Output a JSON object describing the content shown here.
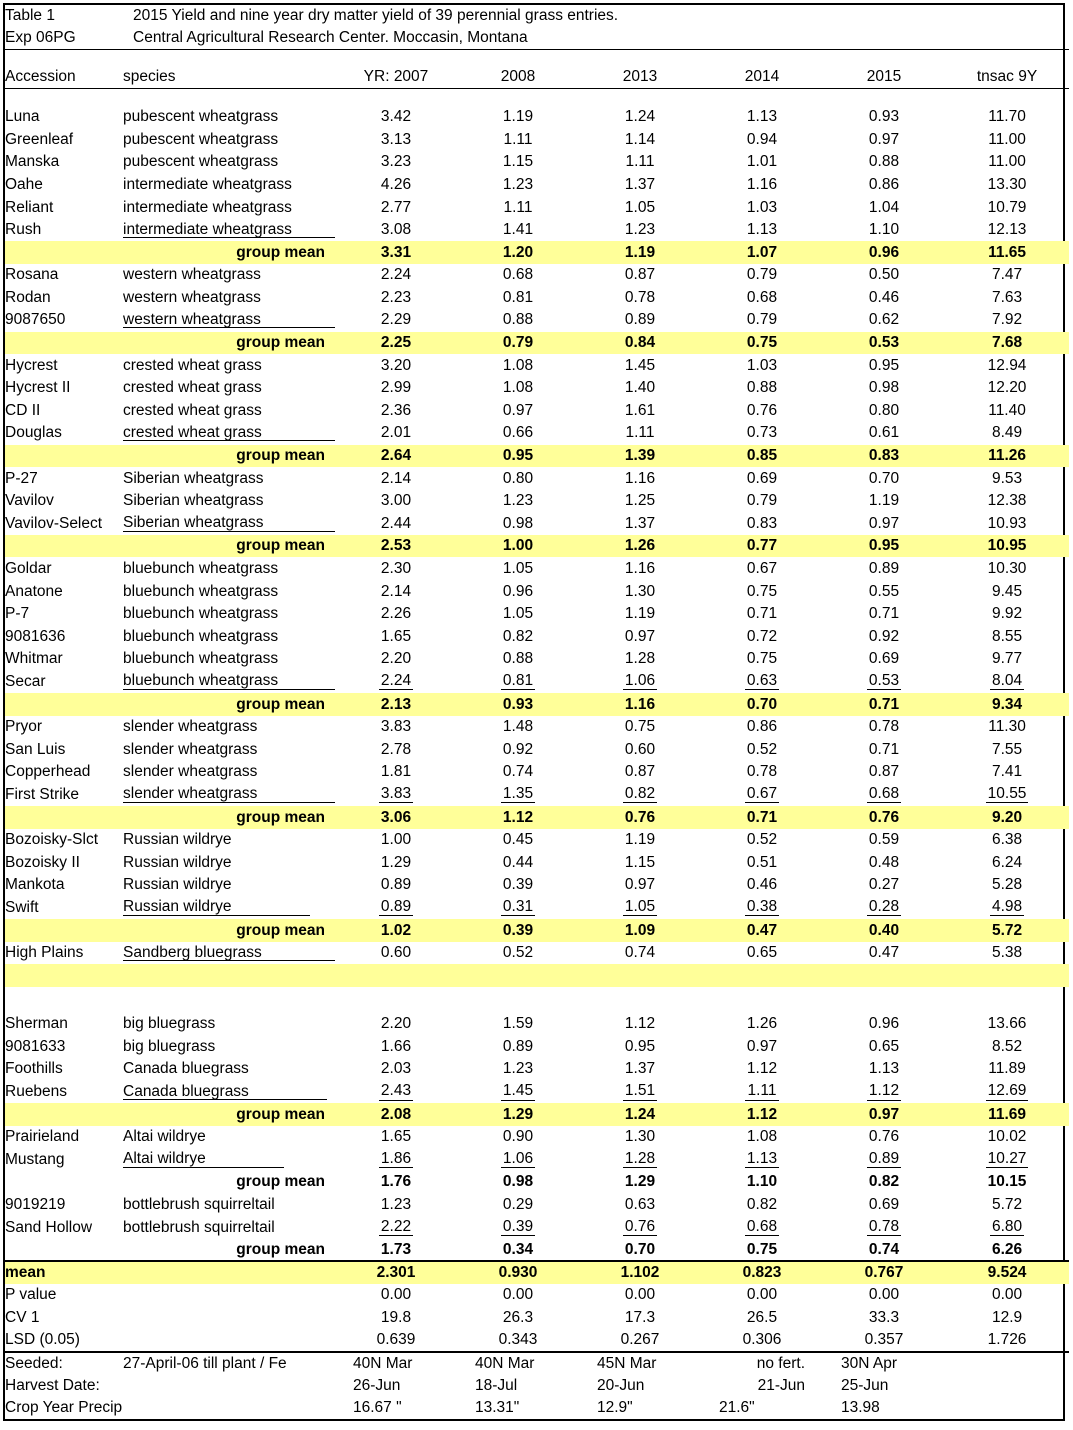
{
  "title": {
    "label": "Table  1",
    "text": "2015 Yield and nine year dry matter yield of 39 perennial grass entries.",
    "exp_label": "Exp 06PG",
    "exp_text": "Central Agricultural Research Center. Moccasin, Montana"
  },
  "colors": {
    "highlight": "#ffff99",
    "border": "#000000",
    "background": "#ffffff"
  },
  "headers": {
    "accession": "Accession",
    "species": "species",
    "year_2007": "YR: 2007",
    "year_2008": "2008",
    "year_2013": "2013",
    "year_2014": "2014",
    "year_2015": "2015",
    "total": "tnsac 9Y"
  },
  "group_mean_label": "group mean",
  "groups": [
    {
      "rows": [
        {
          "accession": "Luna",
          "species": "pubescent wheatgrass",
          "v": [
            "3.42",
            "1.19",
            "1.24",
            "1.13",
            "0.93",
            "11.70"
          ]
        },
        {
          "accession": "Greenleaf",
          "species": "pubescent wheatgrass",
          "v": [
            "3.13",
            "1.11",
            "1.14",
            "0.94",
            "0.97",
            "11.00"
          ]
        },
        {
          "accession": "Manska",
          "species": "pubescent wheatgrass",
          "v": [
            "3.23",
            "1.15",
            "1.11",
            "1.01",
            "0.88",
            "11.00"
          ]
        },
        {
          "accession": "Oahe",
          "species": "intermediate wheatgrass",
          "v": [
            "4.26",
            "1.23",
            "1.37",
            "1.16",
            "0.86",
            "13.30"
          ]
        },
        {
          "accession": "Reliant",
          "species": "intermediate wheatgrass",
          "v": [
            "2.77",
            "1.11",
            "1.05",
            "1.03",
            "1.04",
            "10.79"
          ]
        },
        {
          "accession": "Rush",
          "species": "intermediate wheatgrass",
          "v": [
            "3.08",
            "1.41",
            "1.23",
            "1.13",
            "1.10",
            "12.13"
          ],
          "underline_species": true
        }
      ],
      "mean": {
        "v": [
          "3.31",
          "1.20",
          "1.19",
          "1.07",
          "0.96",
          "11.65"
        ],
        "highlight": true
      }
    },
    {
      "rows": [
        {
          "accession": "Rosana",
          "species": "western wheatgrass",
          "v": [
            "2.24",
            "0.68",
            "0.87",
            "0.79",
            "0.50",
            "7.47"
          ]
        },
        {
          "accession": "Rodan",
          "species": "western wheatgrass",
          "v": [
            "2.23",
            "0.81",
            "0.78",
            "0.68",
            "0.46",
            "7.63"
          ]
        },
        {
          "accession": "9087650",
          "species": "western wheatgrass",
          "v": [
            "2.29",
            "0.88",
            "0.89",
            "0.79",
            "0.62",
            "7.92"
          ],
          "underline_species": true
        }
      ],
      "mean": {
        "v": [
          "2.25",
          "0.79",
          "0.84",
          "0.75",
          "0.53",
          "7.68"
        ],
        "highlight": true
      }
    },
    {
      "rows": [
        {
          "accession": "Hycrest",
          "species": "crested wheat grass",
          "v": [
            "3.20",
            "1.08",
            "1.45",
            "1.03",
            "0.95",
            "12.94"
          ]
        },
        {
          "accession": "Hycrest II",
          "species": "crested wheat grass",
          "v": [
            "2.99",
            "1.08",
            "1.40",
            "0.88",
            "0.98",
            "12.20"
          ]
        },
        {
          "accession": "CD II",
          "species": "crested wheat grass",
          "v": [
            "2.36",
            "0.97",
            "1.61",
            "0.76",
            "0.80",
            "11.40"
          ]
        },
        {
          "accession": "Douglas",
          "species": "crested wheat grass",
          "v": [
            "2.01",
            "0.66",
            "1.11",
            "0.73",
            "0.61",
            "8.49"
          ],
          "underline_species": true
        }
      ],
      "mean": {
        "v": [
          "2.64",
          "0.95",
          "1.39",
          "0.85",
          "0.83",
          "11.26"
        ],
        "highlight": true
      }
    },
    {
      "rows": [
        {
          "accession": "P-27",
          "species": "Siberian wheatgrass",
          "v": [
            "2.14",
            "0.80",
            "1.16",
            "0.69",
            "0.70",
            "9.53"
          ]
        },
        {
          "accession": "Vavilov",
          "species": "Siberian wheatgrass",
          "v": [
            "3.00",
            "1.23",
            "1.25",
            "0.79",
            "1.19",
            "12.38"
          ]
        },
        {
          "accession": "Vavilov-Select",
          "species": "Siberian wheatgrass",
          "v": [
            "2.44",
            "0.98",
            "1.37",
            "0.83",
            "0.97",
            "10.93"
          ],
          "underline_species": true
        }
      ],
      "mean": {
        "v": [
          "2.53",
          "1.00",
          "1.26",
          "0.77",
          "0.95",
          "10.95"
        ],
        "highlight": true
      }
    },
    {
      "rows": [
        {
          "accession": "Goldar",
          "species": "bluebunch wheatgrass",
          "v": [
            "2.30",
            "1.05",
            "1.16",
            "0.67",
            "0.89",
            "10.30"
          ]
        },
        {
          "accession": "Anatone",
          "species": "bluebunch wheatgrass",
          "v": [
            "2.14",
            "0.96",
            "1.30",
            "0.75",
            "0.55",
            "9.45"
          ]
        },
        {
          "accession": "P-7",
          "species": "bluebunch wheatgrass",
          "v": [
            "2.26",
            "1.05",
            "1.19",
            "0.71",
            "0.71",
            "9.92"
          ]
        },
        {
          "accession": "9081636",
          "species": "bluebunch wheatgrass",
          "v": [
            "1.65",
            "0.82",
            "0.97",
            "0.72",
            "0.92",
            "8.55"
          ]
        },
        {
          "accession": "Whitmar",
          "species": "bluebunch wheatgrass",
          "v": [
            "2.20",
            "0.88",
            "1.28",
            "0.75",
            "0.69",
            "9.77"
          ]
        },
        {
          "accession": "Secar",
          "species": "bluebunch wheatgrass",
          "v": [
            "2.24",
            "0.81",
            "1.06",
            "0.63",
            "0.53",
            "8.04"
          ],
          "underline_species": true,
          "underline_values": true
        }
      ],
      "mean": {
        "v": [
          "2.13",
          "0.93",
          "1.16",
          "0.70",
          "0.71",
          "9.34"
        ],
        "highlight": true
      }
    },
    {
      "rows": [
        {
          "accession": "Pryor",
          "species": "slender wheatgrass",
          "v": [
            "3.83",
            "1.48",
            "0.75",
            "0.86",
            "0.78",
            "11.30"
          ]
        },
        {
          "accession": "San Luis",
          "species": "slender wheatgrass",
          "v": [
            "2.78",
            "0.92",
            "0.60",
            "0.52",
            "0.71",
            "7.55"
          ]
        },
        {
          "accession": "Copperhead",
          "species": "slender wheatgrass",
          "v": [
            "1.81",
            "0.74",
            "0.87",
            "0.78",
            "0.87",
            "7.41"
          ]
        },
        {
          "accession": "First Strike",
          "species": "slender wheatgrass",
          "v": [
            "3.83",
            "1.35",
            "0.82",
            "0.67",
            "0.68",
            "10.55"
          ],
          "underline_species": true,
          "underline_values": true
        }
      ],
      "mean": {
        "v": [
          "3.06",
          "1.12",
          "0.76",
          "0.71",
          "0.76",
          "9.20"
        ],
        "highlight": true
      }
    },
    {
      "rows": [
        {
          "accession": "Bozoisky-Slct",
          "species": "Russian wildrye",
          "v": [
            "1.00",
            "0.45",
            "1.19",
            "0.52",
            "0.59",
            "6.38"
          ]
        },
        {
          "accession": "Bozoisky II",
          "species": "Russian wildrye",
          "v": [
            "1.29",
            "0.44",
            "1.15",
            "0.51",
            "0.48",
            "6.24"
          ]
        },
        {
          "accession": "Mankota",
          "species": "Russian wildrye",
          "v": [
            "0.89",
            "0.39",
            "0.97",
            "0.46",
            "0.27",
            "5.28"
          ]
        },
        {
          "accession": "Swift",
          "species": "Russian wildrye",
          "v": [
            "0.89",
            "0.31",
            "1.05",
            "0.38",
            "0.28",
            "4.98"
          ],
          "underline_species": true,
          "underline_values": true
        }
      ],
      "mean": {
        "v": [
          "1.02",
          "0.39",
          "1.09",
          "0.47",
          "0.40",
          "5.72"
        ],
        "highlight": true
      }
    },
    {
      "rows": [
        {
          "accession": "High Plains",
          "species": "Sandberg bluegrass",
          "v": [
            "0.60",
            "0.52",
            "0.74",
            "0.65",
            "0.47",
            "5.38"
          ],
          "underline_species": true
        }
      ],
      "mean": {
        "v": [
          "",
          "",
          "",
          "",
          "",
          ""
        ],
        "highlight": true
      },
      "gap_after": true
    },
    {
      "rows": [
        {
          "accession": "Sherman",
          "species": "big bluegrass",
          "v": [
            "2.20",
            "1.59",
            "1.12",
            "1.26",
            "0.96",
            "13.66"
          ]
        },
        {
          "accession": "9081633",
          "species": "big bluegrass",
          "v": [
            "1.66",
            "0.89",
            "0.95",
            "0.97",
            "0.65",
            "8.52"
          ]
        },
        {
          "accession": "Foothills",
          "species": "Canada bluegrass",
          "v": [
            "2.03",
            "1.23",
            "1.37",
            "1.12",
            "1.13",
            "11.89"
          ]
        },
        {
          "accession": "Ruebens",
          "species": "Canada bluegrass",
          "v": [
            "2.43",
            "1.45",
            "1.51",
            "1.11",
            "1.12",
            "12.69"
          ],
          "underline_species": true,
          "underline_values": true
        }
      ],
      "mean": {
        "v": [
          "2.08",
          "1.29",
          "1.24",
          "1.12",
          "0.97",
          "11.69"
        ],
        "highlight": true
      }
    },
    {
      "rows": [
        {
          "accession": "Prairieland",
          "species": "Altai wildrye",
          "v": [
            "1.65",
            "0.90",
            "1.30",
            "1.08",
            "0.76",
            "10.02"
          ]
        },
        {
          "accession": "Mustang",
          "species": "Altai wildrye",
          "v": [
            "1.86",
            "1.06",
            "1.28",
            "1.13",
            "0.89",
            "10.27"
          ],
          "underline_species": true,
          "underline_values": true
        }
      ],
      "mean": {
        "v": [
          "1.76",
          "0.98",
          "1.29",
          "1.10",
          "0.82",
          "10.15"
        ],
        "highlight": false
      }
    },
    {
      "rows": [
        {
          "accession": "9019219",
          "species": "bottlebrush squirreltail",
          "v": [
            "1.23",
            "0.29",
            "0.63",
            "0.82",
            "0.69",
            "5.72"
          ]
        },
        {
          "accession": "Sand Hollow",
          "species": "bottlebrush squirreltail",
          "v": [
            "2.22",
            "0.39",
            "0.76",
            "0.68",
            "0.78",
            "6.80"
          ],
          "underline_values": true
        }
      ],
      "mean": {
        "v": [
          "1.73",
          "0.34",
          "0.70",
          "0.75",
          "0.74",
          "6.26"
        ],
        "highlight": false
      }
    }
  ],
  "stats": [
    {
      "label": "mean",
      "v": [
        "2.301",
        "0.930",
        "1.102",
        "0.823",
        "0.767",
        "9.524"
      ],
      "highlight": true,
      "bold": true
    },
    {
      "label": "P value",
      "v": [
        "0.00",
        "0.00",
        "0.00",
        "0.00",
        "0.00",
        "0.00"
      ],
      "highlight": false,
      "bold": false
    },
    {
      "label": "CV 1",
      "v": [
        "19.8",
        "26.3",
        "17.3",
        "26.5",
        "33.3",
        "12.9"
      ],
      "highlight": false,
      "bold": false
    },
    {
      "label": "LSD (0.05)",
      "v": [
        "0.639",
        "0.343",
        "0.267",
        "0.306",
        "0.357",
        "1.726"
      ],
      "highlight": false,
      "bold": false
    }
  ],
  "notes": {
    "seeded_label": "Seeded:",
    "seeded_text": "27-April-06 till plant /   Fe",
    "seeded_v": [
      "40N Mar",
      "40N Mar",
      "45N Mar",
      "no fert.",
      "30N Apr",
      ""
    ],
    "harvest_label": "Harvest Date:",
    "harvest_v": [
      "26-Jun",
      "18-Jul",
      "20-Jun",
      "21-Jun",
      "25-Jun",
      ""
    ],
    "precip_label": "Crop Year Precip.:",
    "precip_v": [
      "16.67 \"",
      "13.31\"",
      "12.9\"",
      "21.6\"",
      "13.98",
      ""
    ]
  }
}
